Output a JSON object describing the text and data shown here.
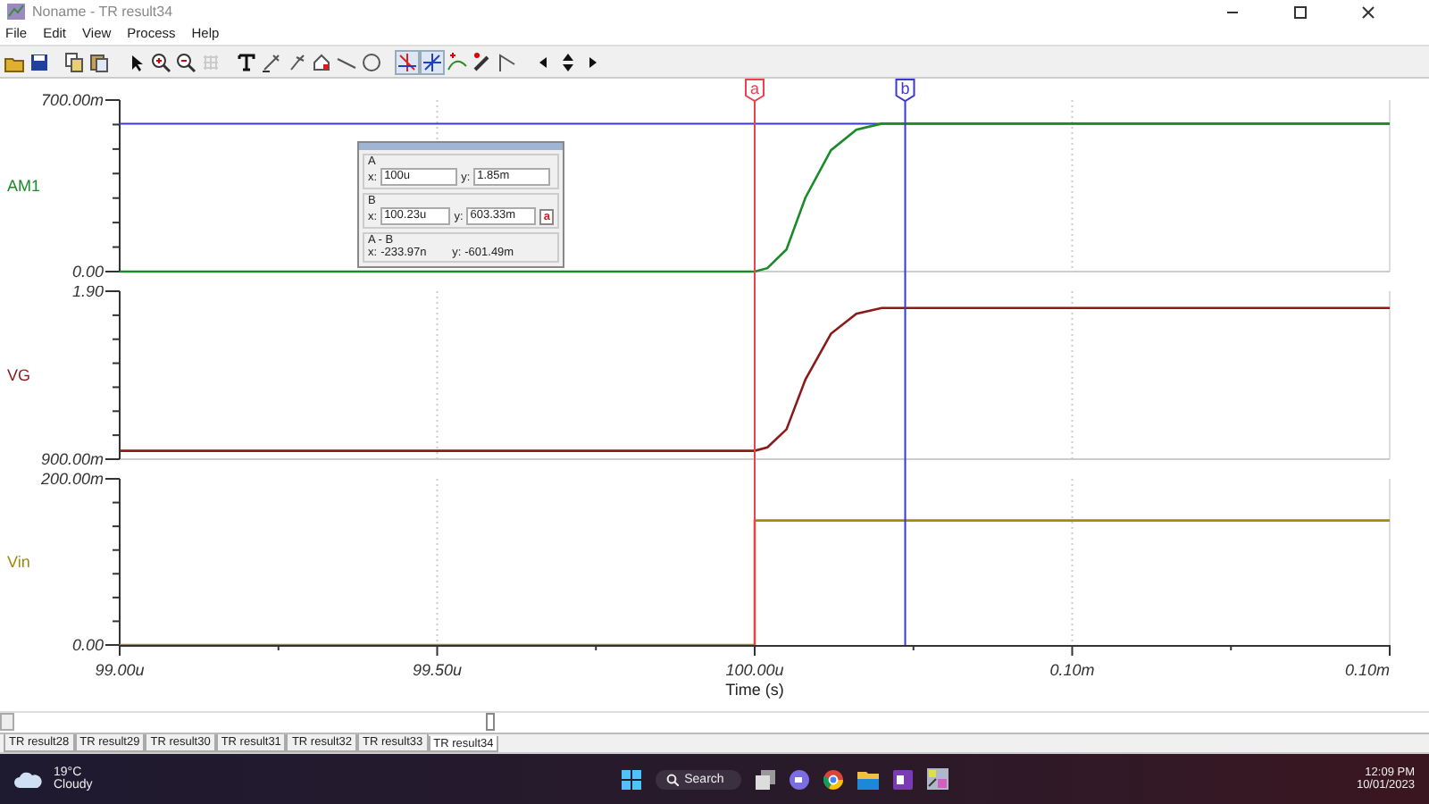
{
  "window": {
    "title": "Noname - TR result34"
  },
  "menu": [
    "File",
    "Edit",
    "View",
    "Process",
    "Help"
  ],
  "plots": [
    {
      "label": "AM1",
      "top_tick": "700.00m",
      "bottom_tick": "0.00",
      "kind": "ramp",
      "color": "#1a8a2a"
    },
    {
      "label": "VG",
      "top_tick": "1.90",
      "bottom_tick": "900.00m",
      "kind": "ramp",
      "color": "#8b1a1a"
    },
    {
      "label": "Vin",
      "top_tick": "200.00m",
      "bottom_tick": "0.00",
      "kind": "step",
      "color": "#a08a10"
    }
  ],
  "x_axis": {
    "ticks": [
      "99.00u",
      "99.50u",
      "100.00u",
      "0.10m",
      "0.10m"
    ],
    "title": "Time (s)"
  },
  "cursors": [
    {
      "label": "a",
      "color": "#f04050"
    },
    {
      "label": "b",
      "color": "#3a3ad0"
    }
  ],
  "cursor_box": {
    "a": {
      "title": "A",
      "x_caption": "x:",
      "x": "100u",
      "y_caption": "y:",
      "y": "1.85m"
    },
    "b": {
      "title": "B",
      "x_caption": "x:",
      "x": "100.23u",
      "y_caption": "y:",
      "y": "603.33m",
      "button": "a"
    },
    "diff": {
      "title": "A - B",
      "x_caption": "x:",
      "x": "-233.97n",
      "y_caption": "y:",
      "y": "-601.49m"
    }
  },
  "tabs": [
    {
      "label": "TR result28",
      "selected": false
    },
    {
      "label": "TR result29",
      "selected": false
    },
    {
      "label": "TR result30",
      "selected": false
    },
    {
      "label": "TR result31",
      "selected": false
    },
    {
      "label": "TR result32",
      "selected": false
    },
    {
      "label": "TR result33",
      "selected": false
    },
    {
      "label": "TR result34",
      "selected": true
    }
  ],
  "taskbar": {
    "temperature": "19°C",
    "weather": "Cloudy",
    "search": "Search",
    "time": "12:09 PM",
    "date": "10/01/2023"
  }
}
